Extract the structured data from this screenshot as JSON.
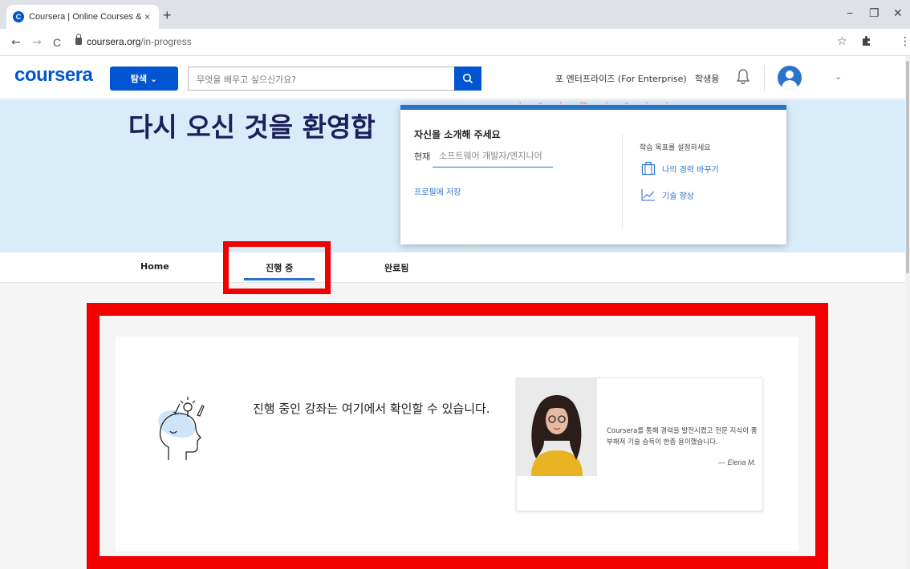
{
  "browser": {
    "tab_title": "Coursera | Online Courses & Cr",
    "tab_favicon": "C",
    "close_glyph": "×",
    "new_tab_glyph": "+",
    "url_host": "coursera.org",
    "url_path": "/in-progress",
    "back_glyph": "←",
    "forward_glyph": "→",
    "reload_glyph": "C",
    "star_glyph": "☆",
    "menu_glyph": "⋮",
    "minimize_glyph": "−",
    "maximize_glyph": "❐",
    "window_close_glyph": "✕"
  },
  "header": {
    "logo": "coursera",
    "explore_label": "탐색 ⌄",
    "search_placeholder": "무엇을 배우고 싶으신가요?",
    "enterprise_link": "포 엔터프라이즈 (For Enterprise)",
    "student_link": "학생용",
    "chevron": "⌄",
    "brand_color": "#0056d2"
  },
  "hero": {
    "welcome_text": "다시 오신 것을 환영합"
  },
  "popover": {
    "title": "자신을 소개해 주세요",
    "current_label": "현재",
    "current_placeholder": "소프트웨어 개발자/엔지니어",
    "save_link": "프로필에 저장",
    "goal_heading": "학습 목표를 설정하세요",
    "options": [
      {
        "label": "나의 경력 바꾸기",
        "icon": "briefcase-icon"
      },
      {
        "label": "기술 향상",
        "icon": "trend-line-icon"
      }
    ]
  },
  "nav": {
    "tabs": [
      "Home",
      "진행 중",
      "완료됨"
    ],
    "active_index": 1
  },
  "main": {
    "empty_message": "진행 중인 강좌는 여기에서 확인할 수 있습니다.",
    "empty_icon": "head-lightbulb-icon",
    "testimonial": {
      "quote": "Coursera를 통해 경력을 발전시켰고 전문 지식이 풍부해져 기술 습득이 한층 용이했습니다.",
      "author": "— Elena M."
    }
  },
  "annotations": {
    "highlight_color": "#f20000"
  }
}
